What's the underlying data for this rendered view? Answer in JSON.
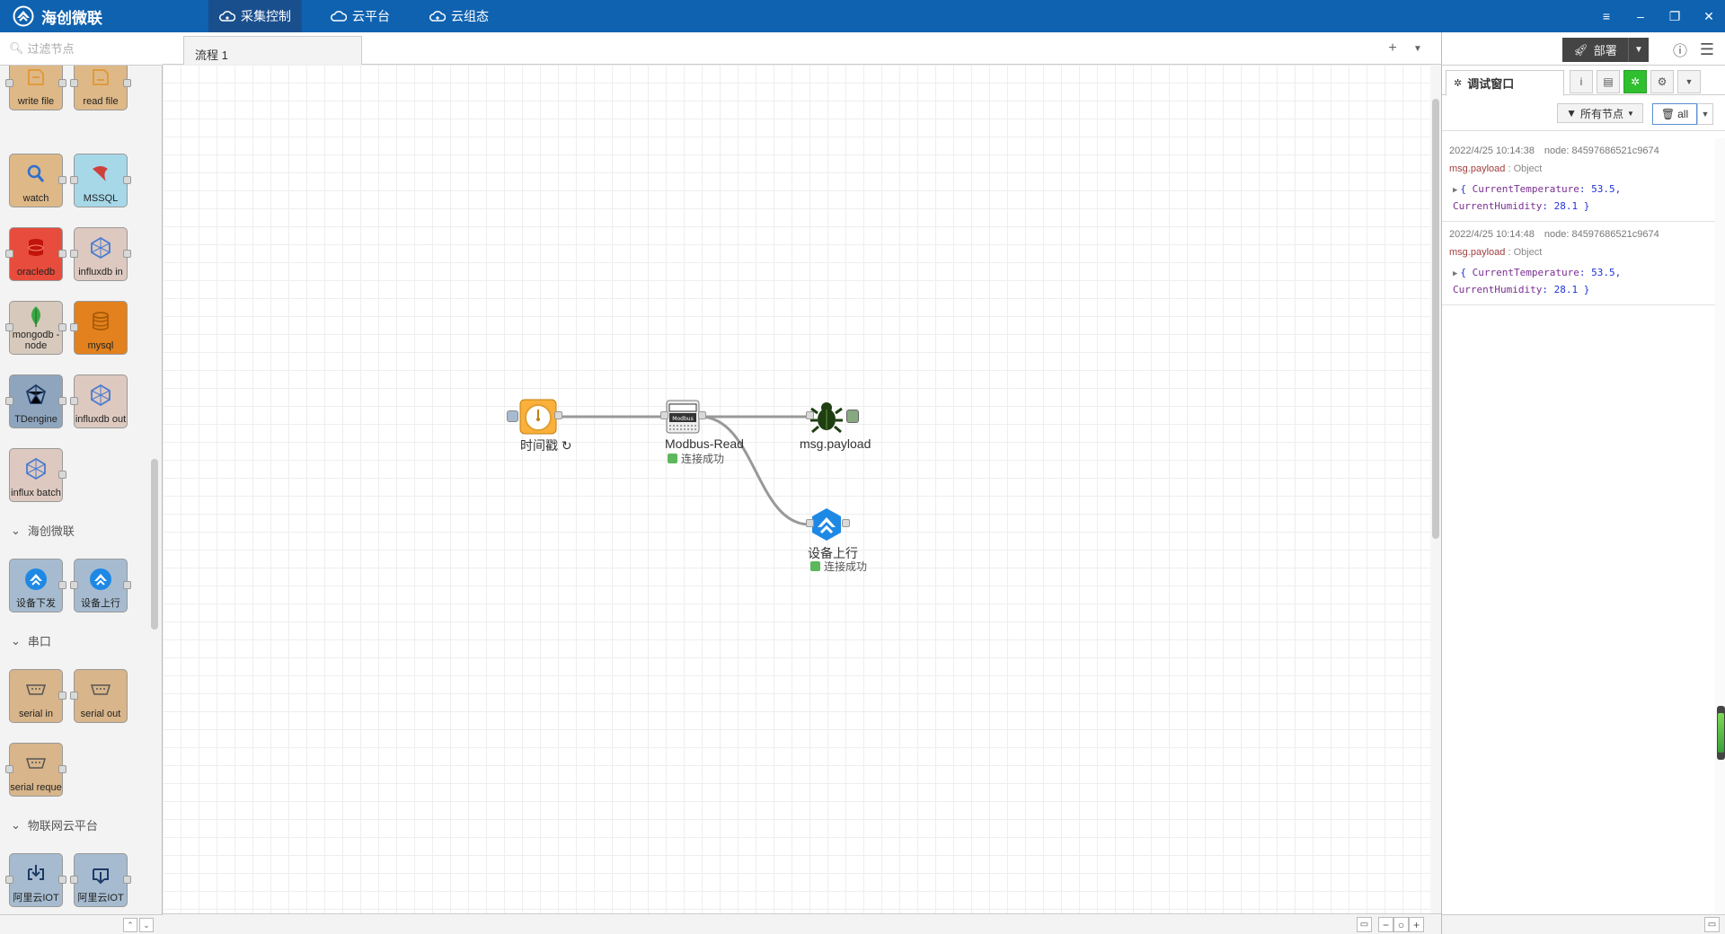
{
  "app": {
    "brand": "海创微联",
    "main_tabs": [
      {
        "label": "采集控制",
        "icon": "cloud-gear-icon",
        "active": true
      },
      {
        "label": "云平台",
        "icon": "cloud-icon",
        "active": false
      },
      {
        "label": "云组态",
        "icon": "cloud-settings-icon",
        "active": false
      }
    ],
    "window_controls": {
      "menu": "≡",
      "minimize": "–",
      "restore": "❐",
      "close": "✕"
    }
  },
  "palette": {
    "filter_placeholder": "过滤节点",
    "nodes": [
      {
        "label": "write file",
        "color": "#deb887",
        "icon": "file-out-icon"
      },
      {
        "label": "read file",
        "color": "#deb887",
        "icon": "file-in-icon"
      },
      {
        "label": "watch",
        "color": "#deb887",
        "icon": "magnifier-icon"
      },
      {
        "label": "MSSQL",
        "color": "#a6d8e8",
        "icon": "mssql-icon"
      },
      {
        "label": "oracledb",
        "color": "#e74c3c",
        "icon": "database-red-icon"
      },
      {
        "label": "influxdb in",
        "color": "#ddc9c0",
        "icon": "influx-cube-icon"
      },
      {
        "label": "mongodb - node",
        "color": "#d7c9bc",
        "icon": "leaf-icon"
      },
      {
        "label": "mysql",
        "color": "#e2811d",
        "icon": "database-icon"
      },
      {
        "label": "TDengine",
        "color": "#8ea5bd",
        "icon": "tdengine-icon"
      },
      {
        "label": "influxdb out",
        "color": "#ddc9c0",
        "icon": "influx-cube-icon"
      },
      {
        "label": "influx batch",
        "color": "#ddc9c0",
        "icon": "influx-cube-icon"
      },
      {
        "label": "设备下发",
        "color": "#a6bbcf",
        "icon": "haichuang-logo-icon"
      },
      {
        "label": "设备上行",
        "color": "#a6bbcf",
        "icon": "haichuang-logo-icon"
      },
      {
        "label": "serial in",
        "color": "#d8b58a",
        "icon": "serial-port-icon"
      },
      {
        "label": "serial out",
        "color": "#d8b58a",
        "icon": "serial-port-icon"
      },
      {
        "label": "serial reque",
        "color": "#d8b58a",
        "icon": "serial-port-icon"
      },
      {
        "label": "阿里云IOT",
        "color": "#a6bbcf",
        "icon": "aliyun-in-icon"
      },
      {
        "label": "阿里云IOT",
        "color": "#a6bbcf",
        "icon": "aliyun-out-icon"
      }
    ],
    "categories": [
      "海创微联",
      "串口",
      "物联网云平台"
    ]
  },
  "workspace": {
    "flow_tab": "流程 1",
    "nodes": [
      {
        "label": "时间戳 ↻",
        "icon": "timer-icon",
        "color": "#fbb03b"
      },
      {
        "label": "Modbus-Read",
        "icon": "modbus-device-icon",
        "status": "连接成功"
      },
      {
        "label": "msg.payload",
        "icon": "bug-icon"
      },
      {
        "label": "设备上行",
        "icon": "haichuang-logo-icon",
        "status": "连接成功"
      }
    ],
    "status_color": "#5cb85c"
  },
  "sidebar": {
    "deploy_label": "部署",
    "debug_tab": "调试窗口",
    "node_filter": "所有节点",
    "clear_label": "all",
    "messages": [
      {
        "time": "2022/4/25 10:14:38",
        "node": "node: 84597686521c9674",
        "topic": "msg.payload",
        "type": "Object",
        "line1_key": "CurrentTemperature",
        "line1_val": "53.5",
        "line2_key": "CurrentHumidity",
        "line2_val": "28.1"
      },
      {
        "time": "2022/4/25 10:14:48",
        "node": "node: 84597686521c9674",
        "topic": "msg.payload",
        "type": "Object",
        "line1_key": "CurrentTemperature",
        "line1_val": "53.5",
        "line2_key": "CurrentHumidity",
        "line2_val": "28.1"
      }
    ]
  }
}
